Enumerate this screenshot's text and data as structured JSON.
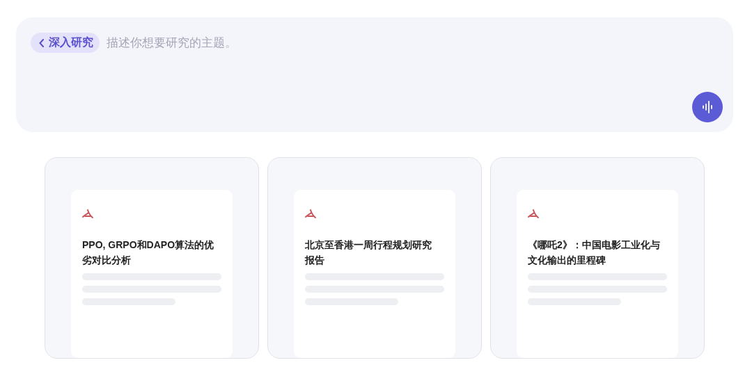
{
  "prompt": {
    "mode_chip": {
      "label": "深入研究"
    },
    "placeholder": "描述你想要研究的主题。"
  },
  "cards": [
    {
      "kind": "pdf",
      "title": "PPO, GRPO和DAPO算法的优劣对比分析"
    },
    {
      "kind": "pdf",
      "title": "北京至香港一周行程规划研究报告"
    },
    {
      "kind": "pdf",
      "title": "《哪吒2》：中国电影工业化与文化输出的里程碑"
    }
  ]
}
